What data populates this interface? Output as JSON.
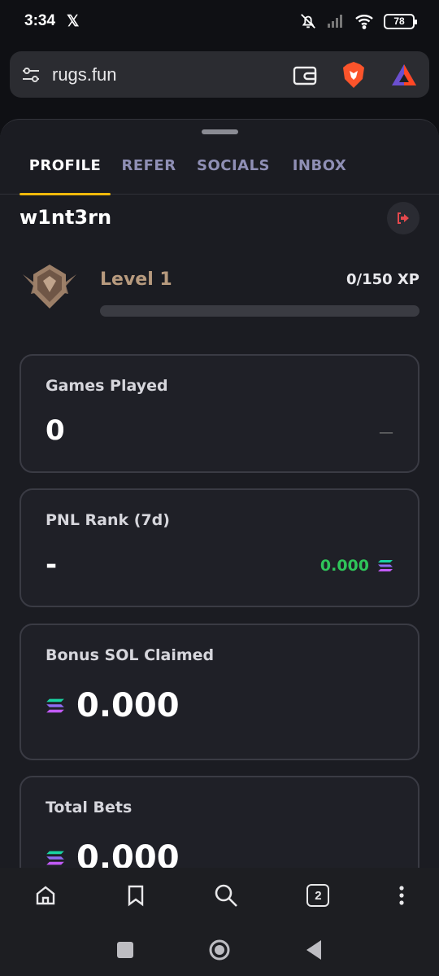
{
  "status": {
    "time": "3:34",
    "battery": "78"
  },
  "browser": {
    "url": "rugs.fun",
    "tab_count": "2"
  },
  "tabs": [
    {
      "label": "PROFILE",
      "active": true
    },
    {
      "label": "REFER",
      "active": false
    },
    {
      "label": "SOCIALS",
      "active": false
    },
    {
      "label": "INBOX",
      "active": false
    }
  ],
  "profile": {
    "username": "w1nt3rn",
    "level": "Level 1",
    "xp": "0/150 XP",
    "xp_progress": 0
  },
  "cards": {
    "games_played": {
      "label": "Games Played",
      "value": "0",
      "trend": "—"
    },
    "pnl_rank": {
      "label": "PNL Rank (7d)",
      "value": "-",
      "pnl": "0.000"
    },
    "bonus_sol": {
      "label": "Bonus SOL Claimed",
      "value": "0.000"
    },
    "total_bets": {
      "label": "Total Bets",
      "value": "0.000"
    }
  },
  "colors": {
    "accent": "#f0b90b",
    "level": "#b79a7e",
    "profit": "#2fc45a",
    "tab_inactive": "#8f8fb5"
  }
}
